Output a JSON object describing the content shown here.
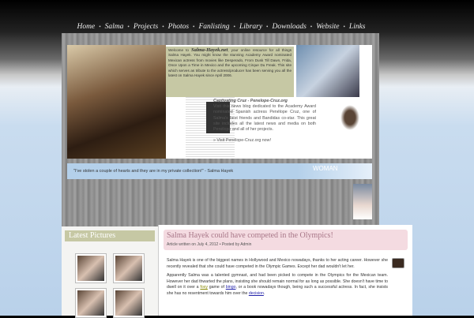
{
  "nav": [
    "Home",
    "Salma",
    "Projects",
    "Photos",
    "Fanlisting",
    "Library",
    "Downloads",
    "Website",
    "Links"
  ],
  "welcome": {
    "pre": "Welcome to",
    "site": "Salma-Hayek.net",
    "text": ", your online resource for all things Salma Hayek. You might know the stunning Academy Award nominated Mexican actress from movies like Desperado, From Dusk Till Dawn, Frida, Once Upon a Time in Mexico and the upcoming Cirque Du Freak. This site which serves as tribute to the actress/producer has been serving you all the latest on Salma Hayek since April 2006."
  },
  "cruz": {
    "title": "Captivating Cruz - Penelope-Cruz.org",
    "text": "Visit this news blog dedicated to the Academy Award nominated Spanish actress Penélope Cruz, one of Salma's best friends and Bandidas co-star. This great site includes all the latest news and media on both Penélope and all of her projects.",
    "link": "» Visit Penélope-Cruz.org now!"
  },
  "quote": "\"I've stolen a couple of hearts and they are in my private collection!\" - Salma Hayek",
  "quote_logo": "WOMAN",
  "sidebar": {
    "title": "Latest Pictures"
  },
  "post": {
    "title": "Salma Hayek could have competed in the Olympics!",
    "meta": "Article written on July 4, 2012 • Posted by Admin",
    "p1": "Salma Hayek is one of the biggest names in Hollywood and Mexico nowadays, thanks to her acting career. However she recently revealed that she could have competed in the Olympic Games. Except her dad wouldn't let her.",
    "p2a": "Apparently Salma was a talented gymnast, and had been picked to compete in the Olympics for the Mexican team. However her dad thwarted the plans, insisting she should remain normal for as long as possible. She doesn't have time to dwell on it over a ",
    "l1": "foxy",
    "p2b": " game of ",
    "l2": "bingo",
    "p2c": ", or a book nowadays though, being such a successful actress. In fact, she insists she has no resentment towards him over the ",
    "l3": "decision",
    "p2d": "."
  }
}
